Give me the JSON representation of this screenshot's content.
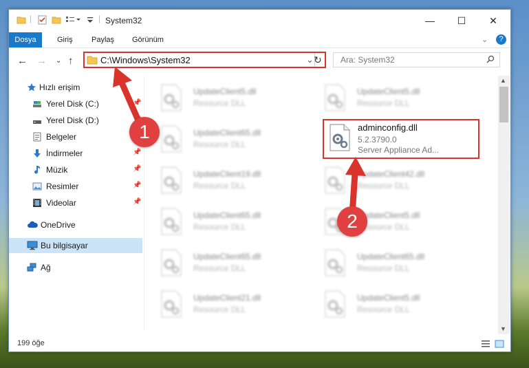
{
  "window": {
    "title": "System32",
    "controls": {
      "minimize": "—",
      "maximize": "☐",
      "close": "✕"
    }
  },
  "ribbon": {
    "tabs": [
      "Dosya",
      "Giriş",
      "Paylaş",
      "Görünüm"
    ],
    "help": "?"
  },
  "address": {
    "path": "C:\\Windows\\System32",
    "search_placeholder": "Ara: System32"
  },
  "sidebar": {
    "items": [
      {
        "label": "Hızlı erişim",
        "icon": "star-icon"
      },
      {
        "label": "Yerel Disk (C:)",
        "icon": "drive-icon",
        "pinned": true
      },
      {
        "label": "Yerel Disk (D:)",
        "icon": "drive-icon",
        "pinned": true
      },
      {
        "label": "Belgeler",
        "icon": "documents-icon",
        "pinned": true
      },
      {
        "label": "İndirmeler",
        "icon": "download-icon",
        "pinned": true
      },
      {
        "label": "Müzik",
        "icon": "music-icon",
        "pinned": true
      },
      {
        "label": "Resimler",
        "icon": "pictures-icon",
        "pinned": true
      },
      {
        "label": "Videolar",
        "icon": "videos-icon",
        "pinned": true
      },
      {
        "label": "OneDrive",
        "icon": "cloud-icon"
      },
      {
        "label": "Bu bilgisayar",
        "icon": "computer-icon",
        "selected": true
      },
      {
        "label": "Ağ",
        "icon": "network-icon"
      }
    ]
  },
  "files": {
    "left_column": [
      {
        "name": "UpdateClient5.dll",
        "desc": "Resource DLL"
      },
      {
        "name": "UpdateClient65.dll",
        "desc": "Resource DLL"
      },
      {
        "name": "UpdateClient19.dll",
        "desc": "Resource DLL"
      },
      {
        "name": "UpdateClient65.dll",
        "desc": "Resource DLL"
      },
      {
        "name": "UpdateClient65.dll",
        "desc": "Resource DLL"
      },
      {
        "name": "UpdateClient21.dll",
        "desc": "Resource DLL"
      }
    ],
    "right_column": [
      {
        "name": "UpdateClient5.dll",
        "desc": "Resource DLL"
      },
      {
        "name": "UpdateClient42.dll",
        "desc": "Resource DLL"
      },
      {
        "name": "UpdateClient5.dll",
        "desc": "Resource DLL"
      },
      {
        "name": "UpdateClient65.dll",
        "desc": "Resource DLL"
      },
      {
        "name": "UpdateClient5.dll",
        "desc": "Resource DLL"
      }
    ],
    "highlighted": {
      "name": "adminconfig.dll",
      "version": "5.2.3790.0",
      "description": "Server Appliance Ad..."
    }
  },
  "status": {
    "item_count": "199 öğe"
  },
  "annotations": {
    "step1": "1",
    "step2": "2",
    "color": "#d9342b"
  }
}
